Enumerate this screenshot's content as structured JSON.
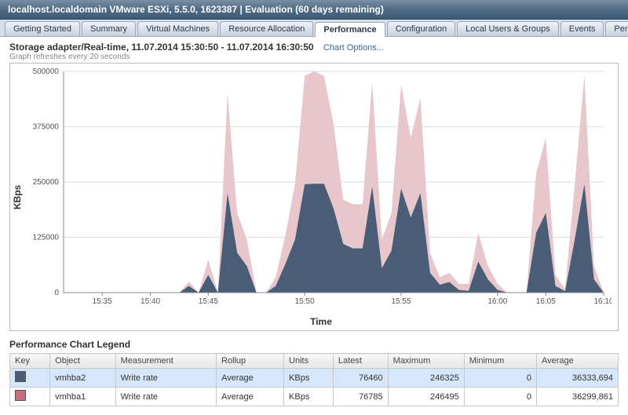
{
  "titlebar": "localhost.localdomain VMware ESXi, 5.5.0, 1623387 | Evaluation (60 days remaining)",
  "tabs": {
    "items": [
      "Getting Started",
      "Summary",
      "Virtual Machines",
      "Resource Allocation",
      "Performance",
      "Configuration",
      "Local Users & Groups",
      "Events",
      "Permissions"
    ],
    "active_index": 4
  },
  "chart_header": {
    "title": "Storage adapter/Real-time, 11.07.2014 15:30:50 - 11.07.2014 16:30:50",
    "options_link": "Chart Options...",
    "refresh_note": "Graph refreshes every 20 seconds"
  },
  "chart_data": {
    "type": "area",
    "xlabel": "Time",
    "ylabel": "KBps",
    "ylim": [
      0,
      500000
    ],
    "yticks": [
      0,
      125000,
      250000,
      375000,
      500000
    ],
    "xticks": [
      "15:35",
      "15:40",
      "15:45",
      "15:50",
      "15:55",
      "16:00",
      "16:05",
      "16:10"
    ],
    "x": [
      "15:31",
      "15:32",
      "15:33",
      "15:34",
      "15:35",
      "15:36",
      "15:37",
      "15:38",
      "15:39",
      "15:40",
      "15:41",
      "15:42",
      "15:43",
      "15:44",
      "15:44:30",
      "15:45",
      "15:45:30",
      "15:46",
      "15:46:30",
      "15:47",
      "15:47:30",
      "15:48",
      "15:48:30",
      "15:49",
      "15:49:30",
      "15:50",
      "15:50:30",
      "15:51",
      "15:51:30",
      "15:52",
      "15:52:30",
      "15:53",
      "15:53:30",
      "15:54",
      "15:54:30",
      "15:55",
      "15:55:30",
      "15:56",
      "15:56:30",
      "15:57",
      "15:57:30",
      "15:58",
      "15:58:30",
      "15:59",
      "15:59:30",
      "16:00",
      "16:01",
      "16:02",
      "16:03",
      "16:04",
      "16:05",
      "16:06",
      "16:07",
      "16:08",
      "16:08:30",
      "16:09",
      "16:10"
    ],
    "series": [
      {
        "name": "vmhba1",
        "color": "#e8c7cc",
        "values": [
          0,
          0,
          0,
          0,
          0,
          0,
          0,
          0,
          0,
          0,
          0,
          0,
          0,
          25000,
          0,
          75000,
          0,
          450000,
          180000,
          120000,
          0,
          0,
          35000,
          130000,
          246000,
          490000,
          500000,
          490000,
          380000,
          210000,
          200000,
          200000,
          475000,
          120000,
          180000,
          470000,
          350000,
          440000,
          90000,
          35000,
          45000,
          20000,
          20000,
          135000,
          60000,
          20000,
          0,
          0,
          0,
          270000,
          350000,
          40000,
          8000,
          245000,
          490000,
          60000,
          0
        ]
      },
      {
        "name": "vmhba2",
        "color": "#4a5d76",
        "values": [
          0,
          0,
          0,
          0,
          0,
          0,
          0,
          0,
          0,
          0,
          0,
          0,
          0,
          15000,
          0,
          40000,
          0,
          225000,
          90000,
          60000,
          0,
          0,
          15000,
          65000,
          120000,
          245000,
          246000,
          246000,
          190000,
          110000,
          100000,
          100000,
          240000,
          55000,
          95000,
          235000,
          170000,
          225000,
          45000,
          18000,
          24000,
          6000,
          4000,
          70000,
          30000,
          6000,
          0,
          0,
          0,
          135000,
          180000,
          15000,
          3000,
          120000,
          245000,
          30000,
          0
        ]
      }
    ]
  },
  "legend": {
    "title": "Performance Chart Legend",
    "columns": [
      "Key",
      "Object",
      "Measurement",
      "Rollup",
      "Units",
      "Latest",
      "Maximum",
      "Minimum",
      "Average"
    ],
    "rows": [
      {
        "selected": true,
        "key_color": "#4a5d76",
        "object": "vmhba2",
        "measurement": "Write rate",
        "rollup": "Average",
        "units": "KBps",
        "latest": "76460",
        "maximum": "246325",
        "minimum": "0",
        "average": "36333,694"
      },
      {
        "selected": false,
        "key_color": "#c96f7b",
        "object": "vmhba1",
        "measurement": "Write rate",
        "rollup": "Average",
        "units": "KBps",
        "latest": "76785",
        "maximum": "246495",
        "minimum": "0",
        "average": "36299,861"
      }
    ]
  }
}
